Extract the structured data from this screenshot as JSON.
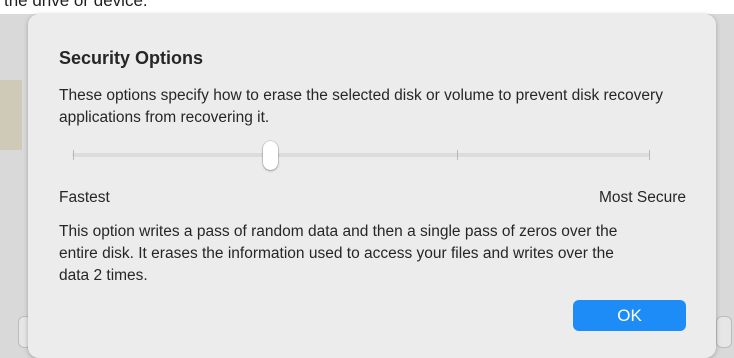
{
  "background": {
    "top_text": "the drive or device."
  },
  "dialog": {
    "title": "Security Options",
    "description": "These options specify how to erase the selected disk or volume to prevent disk recovery applications from recovering it.",
    "slider": {
      "steps": 4,
      "selected_step": 2,
      "min_label": "Fastest",
      "max_label": "Most Secure"
    },
    "option_description": "This option writes a pass of random data and then a single pass of zeros over the entire disk. It erases the information used to access your files and writes over the data 2 times.",
    "ok_label": "OK"
  },
  "colors": {
    "accent": "#1e8cf6",
    "sheet_background": "#ececec"
  }
}
